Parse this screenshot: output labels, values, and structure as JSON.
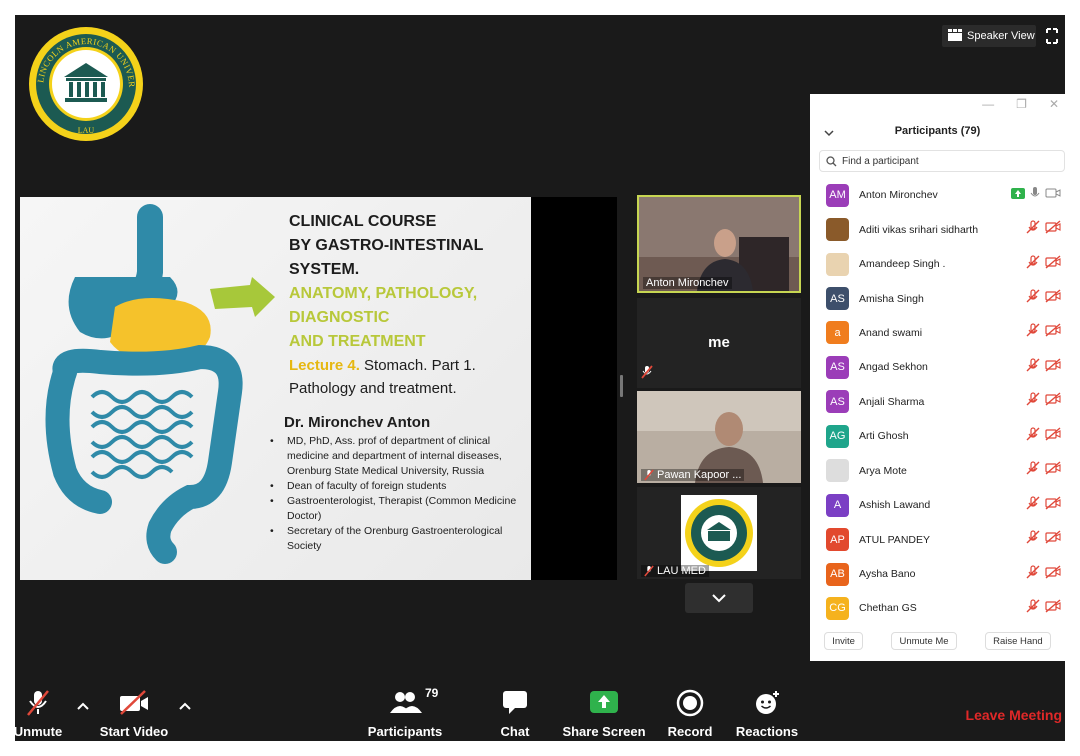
{
  "view": {
    "speaker_view_label": "Speaker View"
  },
  "logo": {
    "arc_text": "LINCOLN AMERICAN UNIVERSITY",
    "bottom_text": "LAU"
  },
  "slide": {
    "title_lines": [
      "CLINICAL COURSE",
      "BY GASTRO-INTESTINAL",
      "SYSTEM."
    ],
    "subtitle_lines": [
      "ANATOMY, PATHOLOGY,",
      "DIAGNOSTIC",
      "AND TREATMENT"
    ],
    "lecture_highlight": "Lecture 4.",
    "lecture_rest": "Stomach. Part 1.",
    "lecture_line2": "Pathology and treatment.",
    "author": "Dr. Mironchev Anton",
    "bullets": [
      "MD, PhD, Ass. prof of department of clinical medicine and department of internal diseases, Orenburg State Medical University, Russia",
      "Dean of faculty of foreign students",
      "Gastroenterologist, Therapist (Common Medicine Doctor)",
      "Secretary of the Orenburg Gastroenterological Society"
    ]
  },
  "tiles": {
    "anton": {
      "name": "Anton Mironchev"
    },
    "me": {
      "label": "me"
    },
    "pawan": {
      "name": "Pawan Kapoor ..."
    },
    "lau": {
      "name": "LAU MED"
    }
  },
  "panel": {
    "title": "Participants (79)",
    "search_placeholder": "Find a participant",
    "participants": [
      {
        "name": "Anton Mironchev",
        "initials": "AM",
        "color": "#9b3db8",
        "host": true
      },
      {
        "name": "Aditi vikas srihari sidharth",
        "initials": "",
        "color": "#8a5a2a",
        "photo": true
      },
      {
        "name": "Amandeep Singh .",
        "initials": "",
        "color": "#e9d3b0",
        "photo": true
      },
      {
        "name": "Amisha Singh",
        "initials": "AS",
        "color": "#3d4f6b"
      },
      {
        "name": "Anand swami",
        "initials": "a",
        "color": "#f07d1e"
      },
      {
        "name": "Angad Sekhon",
        "initials": "AS",
        "color": "#9b3db8"
      },
      {
        "name": "Anjali Sharma",
        "initials": "AS",
        "color": "#9b3db8"
      },
      {
        "name": "Arti Ghosh",
        "initials": "AG",
        "color": "#1fa58b"
      },
      {
        "name": "Arya Mote",
        "initials": "",
        "color": "#ddd",
        "photo": true
      },
      {
        "name": "Ashish Lawand",
        "initials": "A",
        "color": "#7b3fc4"
      },
      {
        "name": "ATUL PANDEY",
        "initials": "AP",
        "color": "#e2492e"
      },
      {
        "name": "Aysha Bano",
        "initials": "AB",
        "color": "#e8641c"
      },
      {
        "name": "Chethan GS",
        "initials": "CG",
        "color": "#f5b21e"
      }
    ],
    "footer": {
      "invite": "Invite",
      "unmute_me": "Unmute Me",
      "raise_hand": "Raise Hand"
    }
  },
  "toolbar": {
    "unmute": "Unmute",
    "start_video": "Start Video",
    "participants": "Participants",
    "participants_count": "79",
    "chat": "Chat",
    "share_screen": "Share Screen",
    "record": "Record",
    "reactions": "Reactions",
    "leave": "Leave Meeting"
  },
  "colors": {
    "accent_green": "#2fb24c",
    "active_border": "#c7d652",
    "leave_red": "#e02828",
    "mute_red": "#e0483a"
  }
}
